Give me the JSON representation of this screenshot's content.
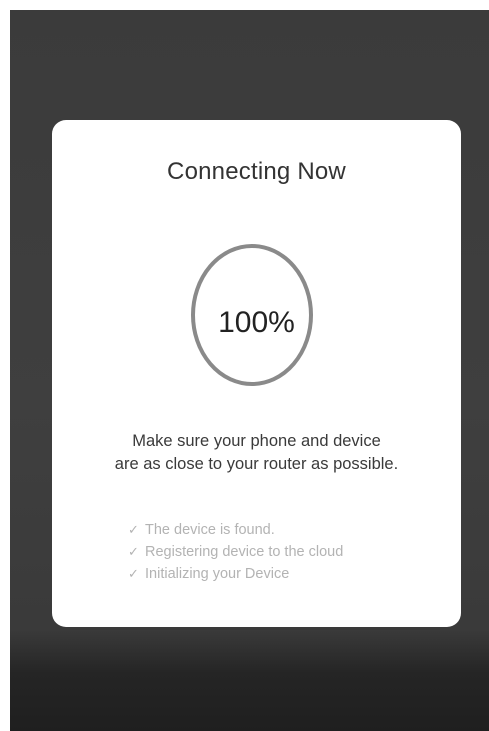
{
  "dialog": {
    "title": "Connecting Now",
    "progress": {
      "value": 1.0,
      "label": "100%"
    },
    "instruction": {
      "line1": "Make sure your phone and device",
      "line2": "are as close to your router as possible."
    },
    "steps": [
      {
        "icon": "check-icon",
        "label": "The device is found."
      },
      {
        "icon": "check-icon",
        "label": "Registering device to the cloud"
      },
      {
        "icon": "check-icon",
        "label": "Initializing your Device"
      }
    ]
  },
  "colors": {
    "overlay": "#3b3b3b",
    "dialog_background": "#ffffff",
    "ring": "#8a8a8a",
    "title_text": "#333333",
    "step_text": "#b3b3b3"
  }
}
